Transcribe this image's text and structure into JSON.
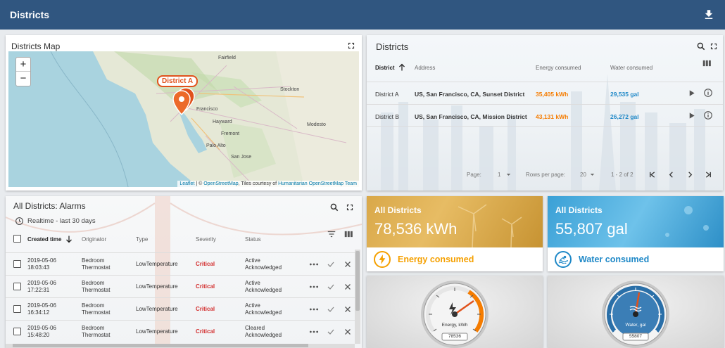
{
  "header": {
    "title": "Districts"
  },
  "map_card": {
    "title": "Districts Map",
    "zoom_in": "+",
    "zoom_out": "−",
    "marker_label": "District A",
    "cities": [
      {
        "name": "Fairfield",
        "key": "fairfield"
      },
      {
        "name": "Stockton",
        "key": "stockton"
      },
      {
        "name": "Francisco",
        "key": "francisco"
      },
      {
        "name": "Hayward",
        "key": "hayward"
      },
      {
        "name": "Modesto",
        "key": "modesto"
      },
      {
        "name": "Fremont",
        "key": "fremont"
      },
      {
        "name": "Palo Alto",
        "key": "paloalto"
      },
      {
        "name": "San Jose",
        "key": "sanjose"
      }
    ],
    "attribution": {
      "leaflet": "Leaflet",
      "sep1": " | © ",
      "osm": "OpenStreetMap",
      "sep2": ", Tiles courtesy of ",
      "hot": "Humanitarian OpenStreetMap Team"
    }
  },
  "districts_table": {
    "title": "Districts",
    "columns": {
      "district": "District",
      "address": "Address",
      "energy": "Energy consumed",
      "water": "Water consumed"
    },
    "rows": [
      {
        "district": "District A",
        "address": "US, San Francisco, CA, Sunset District",
        "energy": "35,405 kWh",
        "water": "29,535 gal"
      },
      {
        "district": "District B",
        "address": "US, San Francisco, CA, Mission District",
        "energy": "43,131 kWh",
        "water": "26,272 gal"
      }
    ],
    "pager": {
      "page_label": "Page:",
      "page_value": "1",
      "rows_label": "Rows per page:",
      "rows_value": "20",
      "range": "1 - 2 of 2"
    }
  },
  "alarms": {
    "title": "All Districts: Alarms",
    "realtime": "Realtime - last 30 days",
    "columns": {
      "created": "Created time",
      "originator": "Originator",
      "type": "Type",
      "severity": "Severity",
      "status": "Status"
    },
    "rows": [
      {
        "date": "2019-05-06",
        "time": "18:03:43",
        "orig1": "Bedroom",
        "orig2": "Thermostat",
        "type": "LowTemperature",
        "severity": "Critical",
        "status1": "Active",
        "status2": "Acknowledged"
      },
      {
        "date": "2019-05-06",
        "time": "17:22:31",
        "orig1": "Bedroom",
        "orig2": "Thermostat",
        "type": "LowTemperature",
        "severity": "Critical",
        "status1": "Active",
        "status2": "Acknowledged"
      },
      {
        "date": "2019-05-06",
        "time": "16:34:12",
        "orig1": "Bedroom",
        "orig2": "Thermostat",
        "type": "LowTemperature",
        "severity": "Critical",
        "status1": "Active",
        "status2": "Acknowledged"
      },
      {
        "date": "2019-05-06",
        "time": "15:48:20",
        "orig1": "Bedroom",
        "orig2": "Thermostat",
        "type": "LowTemperature",
        "severity": "Critical",
        "status1": "Cleared",
        "status2": "Acknowledged"
      }
    ]
  },
  "kpi_energy": {
    "label": "All Districts",
    "value": "78,536 kWh",
    "footer": "Energy consumed",
    "color": "#f5a000"
  },
  "kpi_water": {
    "label": "All Districts",
    "value": "55,807 gal",
    "footer": "Water consumed",
    "color": "#1e88c7"
  },
  "gauge_energy": {
    "label": "Energy, kWh",
    "readout": "78536",
    "accent": "#f57c00"
  },
  "gauge_water": {
    "label": "Water, gal",
    "readout": "55807",
    "accent": "#2a6fa8"
  }
}
